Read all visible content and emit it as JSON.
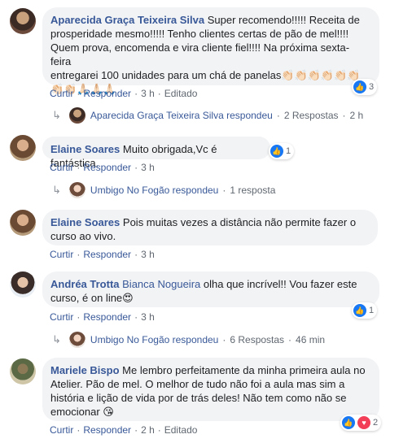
{
  "comments": [
    {
      "author": "Aparecida Graça Teixeira Silva",
      "text_lines": [
        "Super recomendo!!!!! Receita de",
        "prosperidade mesmo!!!!! Tenho clientes certas de pão de mel!!!!",
        "Quem prova, encomenda e vira cliente fiel!!!! Na próxima sexta-feira",
        "entregarei 100 unidades para um chá de panelas👏🏻👏🏻👏🏻👏🏻👏🏻👏🏻",
        "👏🏻👏🏻🙏🏻🙏🏻🙏🏻"
      ],
      "reaction_count": "3",
      "meta": {
        "like": "Curtir",
        "reply": "Responder",
        "time": "3 h",
        "edited": "Editado"
      },
      "replies": {
        "name": "Aparecida Graça Teixeira Silva respondeu",
        "count": "2 Respostas",
        "time": "2 h"
      }
    },
    {
      "author": "Elaine Soares",
      "text": "Muito obrigada,Vc é fantástica.",
      "reaction_count": "1",
      "meta": {
        "like": "Curtir",
        "reply": "Responder",
        "time": "3 h"
      },
      "replies": {
        "name": "Umbigo No Fogão respondeu",
        "count": "1 resposta"
      }
    },
    {
      "author": "Elaine Soares",
      "text_lines": [
        "Pois muitas vezes a distância não permite fazer o",
        "curso ao vivo."
      ],
      "meta": {
        "like": "Curtir",
        "reply": "Responder",
        "time": "3 h"
      }
    },
    {
      "author": "Andréa Trotta",
      "tag": "Bianca Nogueira",
      "text_lines": [
        "olha que incrível!! Vou fazer este",
        "curso, é on line😍"
      ],
      "reaction_count": "1",
      "meta": {
        "like": "Curtir",
        "reply": "Responder",
        "time": "3 h"
      },
      "replies": {
        "name": "Umbigo No Fogão respondeu",
        "count": "6 Respostas",
        "time": "46 min"
      }
    },
    {
      "author": "Mariele Bispo",
      "text_lines": [
        "Me lembro perfeitamente da minha primeira aula no",
        "Atelier. Pão de mel. O melhor de tudo não foi a aula mas sim a",
        "história e lição de vida por de trás deles! Não tem como não se",
        "emocionar 😘"
      ],
      "reaction_count": "2",
      "meta": {
        "like": "Curtir",
        "reply": "Responder",
        "time": "2 h",
        "edited": "Editado"
      }
    }
  ],
  "colors": {
    "link": "#385898",
    "bubble": "#f2f3f5",
    "meta": "#606770",
    "like": "#1877f2",
    "love": "#f33e58"
  }
}
